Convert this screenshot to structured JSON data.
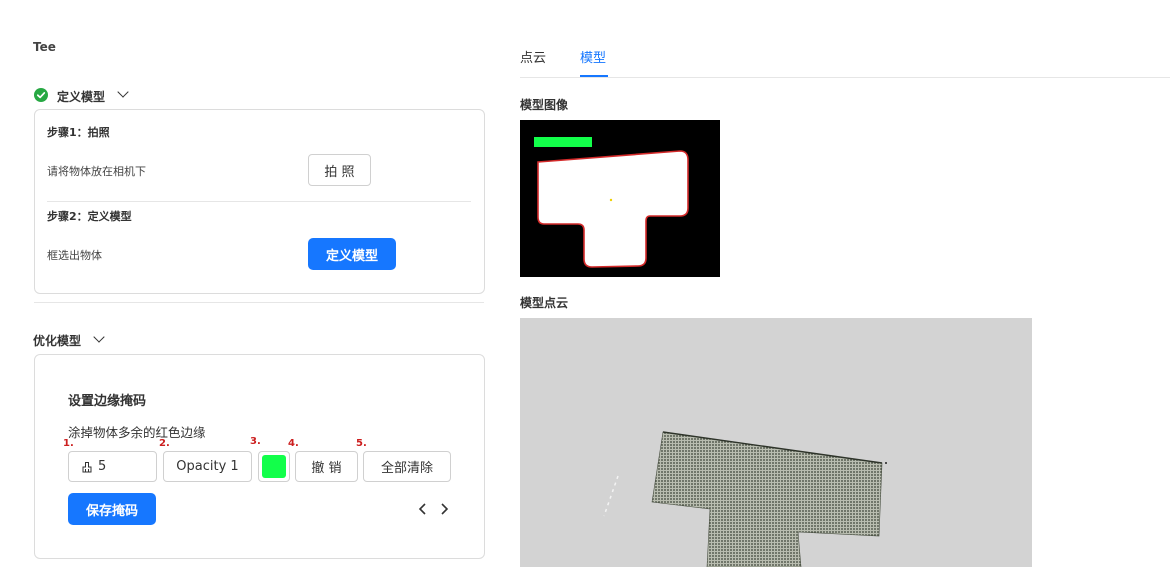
{
  "left": {
    "title": "Tee",
    "define_section": {
      "label": "定义模型",
      "step1": {
        "title": "步骤1：拍照",
        "instruction": "请将物体放在相机下",
        "button": "拍 照"
      },
      "step2": {
        "title": "步骤2：定义模型",
        "instruction": "框选出物体",
        "button": "定义模型"
      }
    },
    "optimize_section": {
      "label": "优化模型",
      "card_title": "设置边缘掩码",
      "description": "涂掉物体多余的红色边缘",
      "tools": {
        "markers": [
          "1.",
          "2.",
          "3.",
          "4.",
          "5."
        ],
        "brush_size": "5",
        "opacity": "Opacity 1",
        "color": "#12ff4a",
        "undo": "撤 销",
        "clear_all": "全部清除"
      },
      "save_button": "保存掩码"
    }
  },
  "right": {
    "tabs": [
      {
        "label": "点云",
        "active": false
      },
      {
        "label": "模型",
        "active": true
      }
    ],
    "model_image_label": "模型图像",
    "model_pointcloud_label": "模型点云"
  },
  "colors": {
    "accent": "#1677ff",
    "success": "#27a843",
    "marker": "#cc1f1f"
  }
}
